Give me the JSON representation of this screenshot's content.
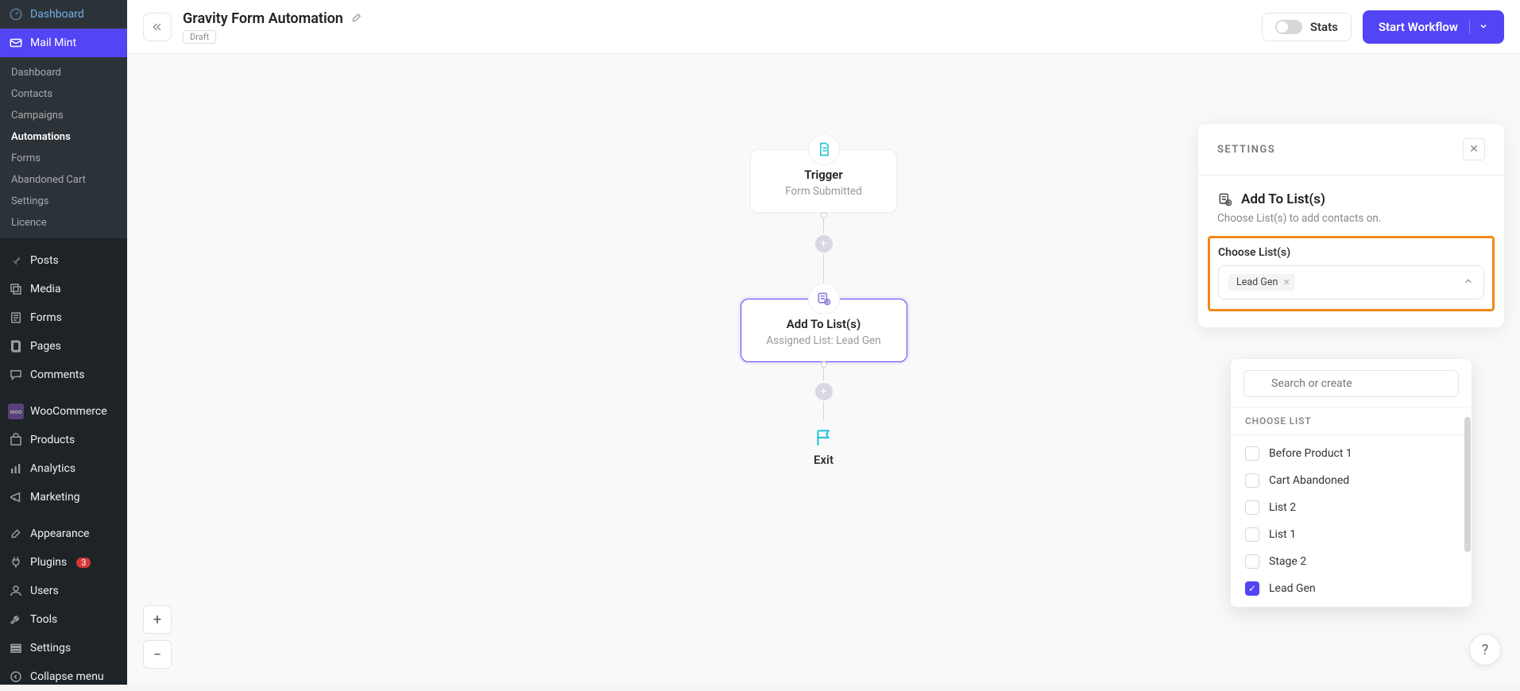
{
  "sidebar": {
    "items": [
      {
        "icon": "gauge",
        "label": "Dashboard"
      },
      {
        "icon": "mail",
        "label": "Mail Mint",
        "active": true
      }
    ],
    "submenu": [
      "Dashboard",
      "Contacts",
      "Campaigns",
      "Automations",
      "Forms",
      "Abandoned Cart",
      "Settings",
      "Licence"
    ],
    "submenu_active": "Automations",
    "items2": [
      {
        "icon": "pin",
        "label": "Posts"
      },
      {
        "icon": "media",
        "label": "Media"
      },
      {
        "icon": "forms",
        "label": "Forms"
      },
      {
        "icon": "page",
        "label": "Pages"
      },
      {
        "icon": "comment",
        "label": "Comments"
      }
    ],
    "items3": [
      {
        "icon": "woo",
        "label": "WooCommerce"
      },
      {
        "icon": "product",
        "label": "Products"
      },
      {
        "icon": "analytics",
        "label": "Analytics"
      },
      {
        "icon": "marketing",
        "label": "Marketing"
      }
    ],
    "items4": [
      {
        "icon": "brush",
        "label": "Appearance"
      },
      {
        "icon": "plug",
        "label": "Plugins",
        "badge": "3"
      },
      {
        "icon": "users",
        "label": "Users"
      },
      {
        "icon": "wrench",
        "label": "Tools"
      },
      {
        "icon": "settings",
        "label": "Settings"
      }
    ],
    "collapse": "Collapse menu"
  },
  "topbar": {
    "title": "Gravity Form Automation",
    "status": "Draft",
    "stats": "Stats",
    "start": "Start Workflow"
  },
  "workflow": {
    "trigger": {
      "title": "Trigger",
      "sub": "Form Submitted"
    },
    "action": {
      "title": "Add To List(s)",
      "sub": "Assigned List: Lead Gen"
    },
    "exit": "Exit"
  },
  "settings": {
    "header": "SETTINGS",
    "step_title": "Add To List(s)",
    "step_sub": "Choose List(s) to add contacts on.",
    "field_label": "Choose List(s)",
    "chip": "Lead Gen",
    "search_placeholder": "Search or create",
    "section_label": "CHOOSE LIST",
    "options": [
      {
        "label": "Before Product 1",
        "checked": false
      },
      {
        "label": "Cart Abandoned",
        "checked": false
      },
      {
        "label": "List 2",
        "checked": false
      },
      {
        "label": "List 1",
        "checked": false
      },
      {
        "label": "Stage 2",
        "checked": false
      },
      {
        "label": "Lead Gen",
        "checked": true
      }
    ]
  }
}
